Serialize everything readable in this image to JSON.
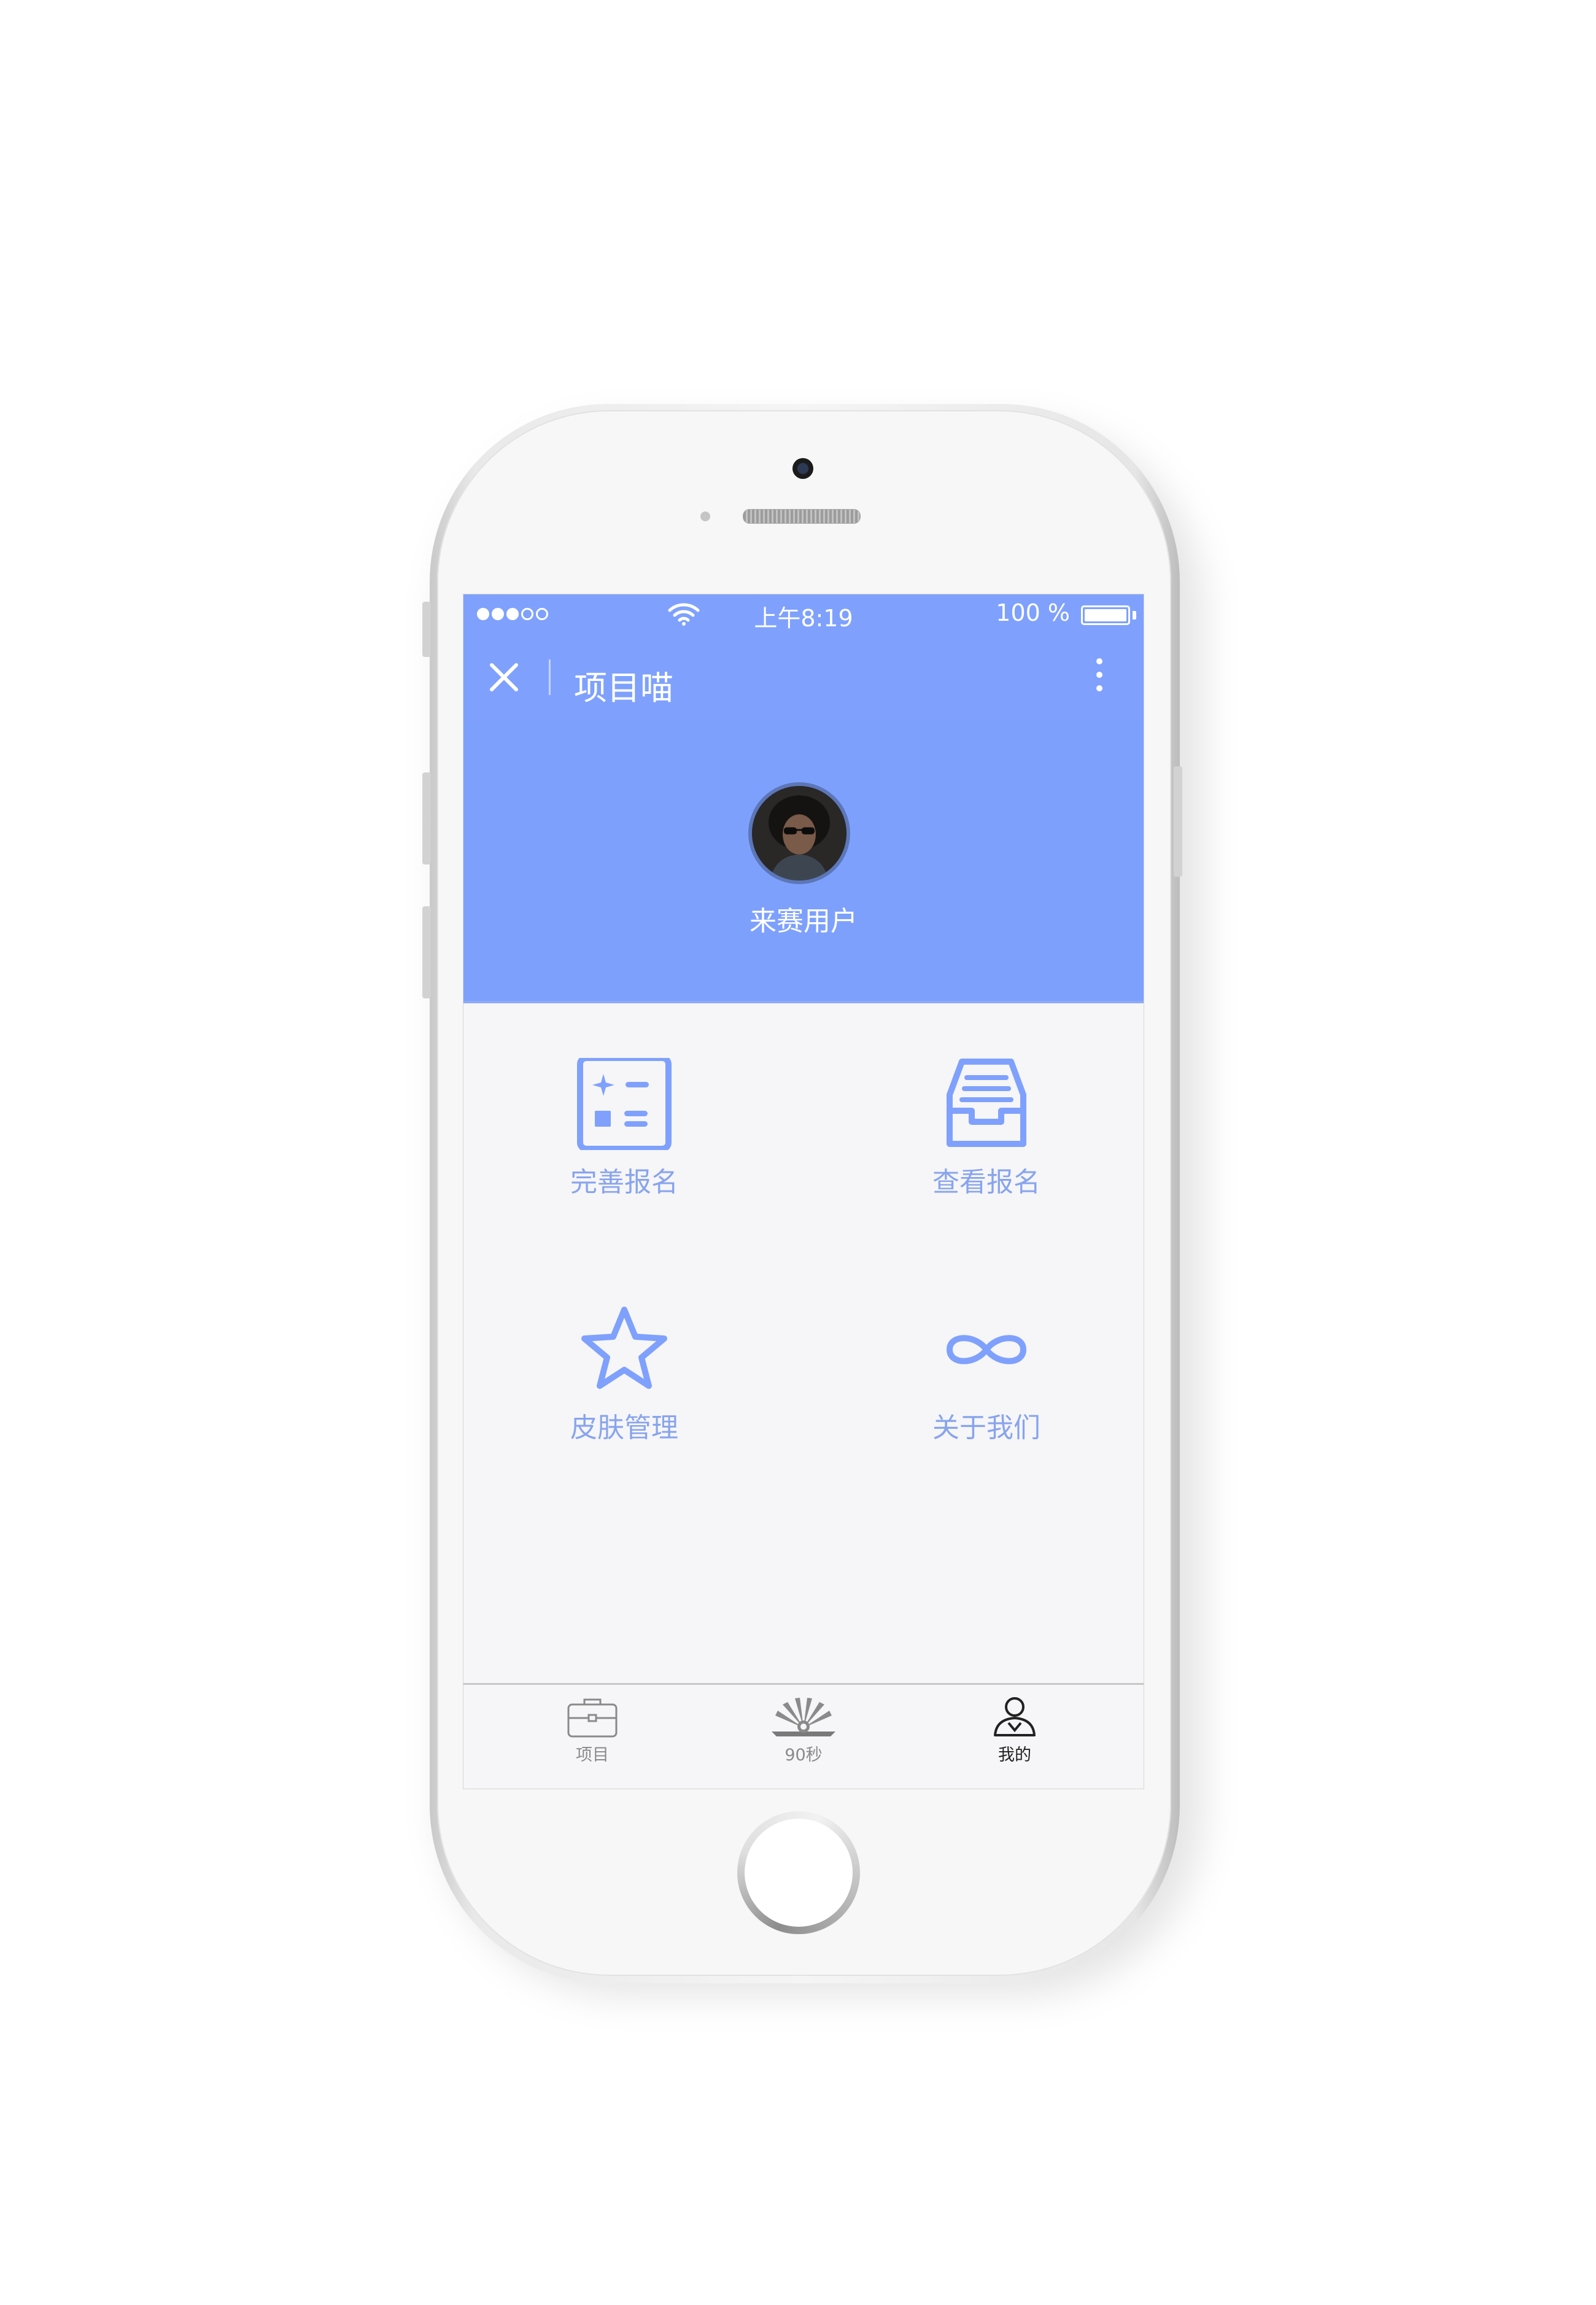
{
  "status_bar": {
    "carrier_signal": "●●●○○",
    "time": "上午8:19",
    "battery": "100 %",
    "battery_level": 1.0
  },
  "nav": {
    "title": "项目喵",
    "close_icon": "close-icon",
    "more_icon": "more-vertical-icon"
  },
  "profile": {
    "username": "来赛用户"
  },
  "menu": [
    {
      "label": "完善报名",
      "icon": "form-icon"
    },
    {
      "label": "查看报名",
      "icon": "inbox-icon"
    },
    {
      "label": "皮肤管理",
      "icon": "star-icon"
    },
    {
      "label": "关于我们",
      "icon": "infinity-icon"
    }
  ],
  "tabs": [
    {
      "label": "项目",
      "icon": "briefcase-icon",
      "active": false
    },
    {
      "label": "90秒",
      "icon": "fan-icon",
      "active": false
    },
    {
      "label": "我的",
      "icon": "user-icon",
      "active": true
    }
  ],
  "colors": {
    "primary": "#7fa1fd",
    "menu_accent": "#88a4ee",
    "background": "#f6f6f8"
  }
}
